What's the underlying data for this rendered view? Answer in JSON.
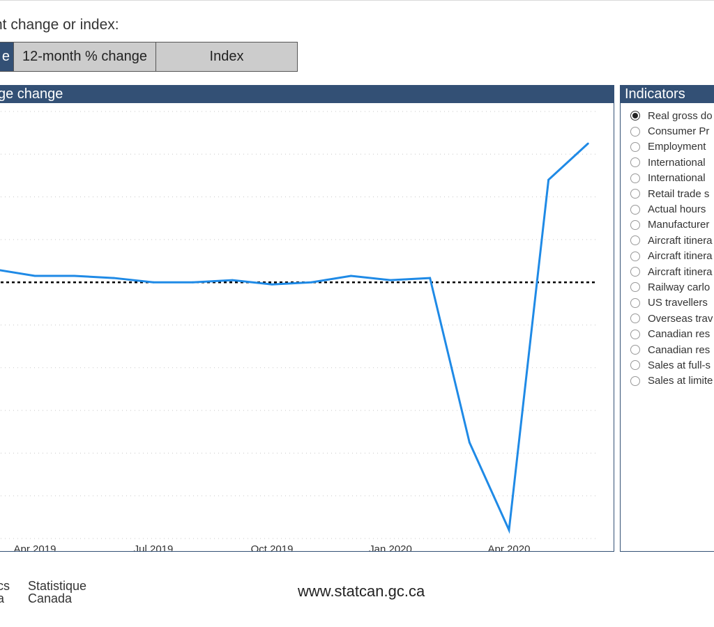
{
  "controls": {
    "prompt": "nt change or index:",
    "buttons": [
      {
        "label": "e",
        "active": true
      },
      {
        "label": "12-month % change",
        "active": false
      },
      {
        "label": "Index",
        "active": false
      }
    ]
  },
  "chart_panel": {
    "title": "ge change"
  },
  "indicators": {
    "title": "Indicators",
    "items": [
      {
        "label": "Real gross do",
        "selected": true
      },
      {
        "label": "Consumer Pr",
        "selected": false
      },
      {
        "label": "Employment",
        "selected": false
      },
      {
        "label": "International",
        "selected": false
      },
      {
        "label": "International",
        "selected": false
      },
      {
        "label": "Retail trade s",
        "selected": false
      },
      {
        "label": "Actual hours",
        "selected": false
      },
      {
        "label": "Manufacturer",
        "selected": false
      },
      {
        "label": "Aircraft itinera",
        "selected": false
      },
      {
        "label": "Aircraft itinera",
        "selected": false
      },
      {
        "label": "Aircraft itinera",
        "selected": false
      },
      {
        "label": "Railway carlo",
        "selected": false
      },
      {
        "label": "US travellers",
        "selected": false
      },
      {
        "label": "Overseas trav",
        "selected": false
      },
      {
        "label": "Canadian res",
        "selected": false
      },
      {
        "label": "Canadian res",
        "selected": false
      },
      {
        "label": "Sales at full-s",
        "selected": false
      },
      {
        "label": "Sales at limite",
        "selected": false
      }
    ]
  },
  "chart_data": {
    "type": "line",
    "x": [
      "2019-02",
      "2019-03",
      "2019-04",
      "2019-05",
      "2019-06",
      "2019-07",
      "2019-08",
      "2019-09",
      "2019-10",
      "2019-11",
      "2019-12",
      "2020-01",
      "2020-02",
      "2020-03",
      "2020-04",
      "2020-05",
      "2020-06"
    ],
    "series": [
      {
        "values": [
          0.6,
          0.3,
          0.3,
          0.2,
          0.0,
          0.0,
          0.1,
          -0.1,
          0.0,
          0.3,
          0.1,
          0.2,
          -7.5,
          -11.6,
          4.8,
          6.5
        ],
        "x_start_index": 1
      }
    ],
    "xtick_labels": [
      "Apr 2019",
      "Jul 2019",
      "Oct 2019",
      "Jan 2020",
      "Apr 2020"
    ],
    "xtick_positions": [
      "2019-04",
      "2019-07",
      "2019-10",
      "2020-01",
      "2020-04"
    ],
    "ylim": [
      -12,
      8
    ],
    "reference_line": 0,
    "grid": true,
    "line_color": "#1f8ae6",
    "reference_color": "#000000"
  },
  "footer": {
    "logo_left_line1": "cs",
    "logo_left_line2": "a",
    "logo_right_line1": "Statistique",
    "logo_right_line2": "Canada",
    "url": "www.statcan.gc.ca"
  },
  "colors": {
    "header": "#335075",
    "button_inactive": "#cccccc"
  }
}
